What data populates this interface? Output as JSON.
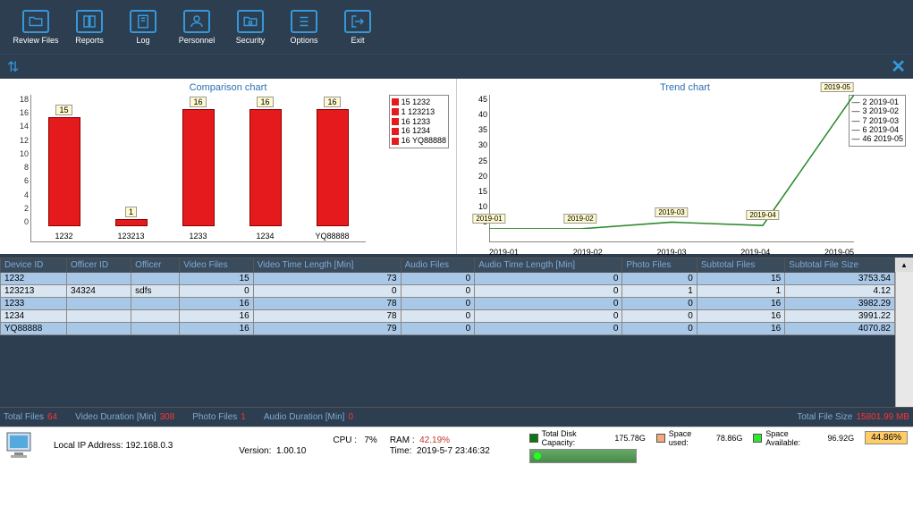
{
  "toolbar": {
    "items": [
      {
        "label": "Review Files",
        "icon": "folder"
      },
      {
        "label": "Reports",
        "icon": "book"
      },
      {
        "label": "Log",
        "icon": "notebook"
      },
      {
        "label": "Personnel",
        "icon": "person"
      },
      {
        "label": "Security",
        "icon": "folder-lock"
      },
      {
        "label": "Options",
        "icon": "list"
      },
      {
        "label": "Exit",
        "icon": "exit"
      }
    ]
  },
  "chart_data": [
    {
      "type": "bar",
      "title": "Comparison chart",
      "categories": [
        "1232",
        "123213",
        "1233",
        "1234",
        "YQ88888"
      ],
      "values": [
        15,
        1,
        16,
        16,
        16
      ],
      "ylim": [
        0,
        18
      ],
      "yticks": [
        0,
        2,
        4,
        6,
        8,
        10,
        12,
        14,
        16,
        18
      ],
      "legend": [
        {
          "color": "#e41a1c",
          "label": "15 1232"
        },
        {
          "color": "#e41a1c",
          "label": "1 123213"
        },
        {
          "color": "#e41a1c",
          "label": "16 1233"
        },
        {
          "color": "#e41a1c",
          "label": "16 1234"
        },
        {
          "color": "#e41a1c",
          "label": "16 YQ88888"
        }
      ]
    },
    {
      "type": "line",
      "title": "Trend chart",
      "x": [
        "2019-01",
        "2019-02",
        "2019-03",
        "2019-04",
        "2019-05"
      ],
      "values": [
        2,
        3,
        7,
        6,
        46
      ],
      "ylim": [
        5,
        45
      ],
      "yticks": [
        5,
        10,
        15,
        20,
        25,
        30,
        35,
        40,
        45
      ],
      "legend": [
        {
          "label": "2 2019-01"
        },
        {
          "label": "3 2019-02"
        },
        {
          "label": "7 2019-03"
        },
        {
          "label": "6 2019-04"
        },
        {
          "label": "46 2019-05"
        }
      ],
      "point_labels": [
        "2019-01",
        "2019-02",
        "2019-03",
        "2019-04",
        "2019-05"
      ]
    }
  ],
  "table": {
    "headers": [
      "Device ID",
      "Officer ID",
      "Officer",
      "Video Files",
      "Video Time Length [Min]",
      "Audio Files",
      "Audio Time Length [Min]",
      "Photo Files",
      "Subtotal Files",
      "Subtotal File Size"
    ],
    "rows": [
      {
        "device_id": "1232",
        "officer_id": "",
        "officer": "",
        "video_files": "15",
        "video_time": "73",
        "audio_files": "0",
        "audio_time": "0",
        "photo_files": "0",
        "subtotal_files": "15",
        "subtotal_size": "3753.54"
      },
      {
        "device_id": "123213",
        "officer_id": "34324",
        "officer": "sdfs",
        "video_files": "0",
        "video_time": "0",
        "audio_files": "0",
        "audio_time": "0",
        "photo_files": "1",
        "subtotal_files": "1",
        "subtotal_size": "4.12"
      },
      {
        "device_id": "1233",
        "officer_id": "",
        "officer": "",
        "video_files": "16",
        "video_time": "78",
        "audio_files": "0",
        "audio_time": "0",
        "photo_files": "0",
        "subtotal_files": "16",
        "subtotal_size": "3982.29"
      },
      {
        "device_id": "1234",
        "officer_id": "",
        "officer": "",
        "video_files": "16",
        "video_time": "78",
        "audio_files": "0",
        "audio_time": "0",
        "photo_files": "0",
        "subtotal_files": "16",
        "subtotal_size": "3991.22"
      },
      {
        "device_id": "YQ88888",
        "officer_id": "",
        "officer": "",
        "video_files": "16",
        "video_time": "79",
        "audio_files": "0",
        "audio_time": "0",
        "photo_files": "0",
        "subtotal_files": "16",
        "subtotal_size": "4070.82"
      }
    ]
  },
  "summary": {
    "total_files_label": "Total Files",
    "total_files": "64",
    "video_duration_label": "Video Duration [Min]",
    "video_duration": "308",
    "photo_files_label": "Photo Files",
    "photo_files": "1",
    "audio_duration_label": "Audio Duration [Min]",
    "audio_duration": "0",
    "total_file_size_label": "Total File Size",
    "total_file_size": "15801.99 MB"
  },
  "status": {
    "ip_label": "Local IP Address:",
    "ip": "192.168.0.3",
    "version_label": "Version:",
    "version": "1.00.10",
    "cpu_label": "CPU :",
    "cpu": "7%",
    "ram_label": "RAM :",
    "ram": "42.19%",
    "time_label": "Time:",
    "time": "2019-5-7 23:46:32",
    "disk_capacity_label": "Total Disk Capacity:",
    "disk_capacity": "175.78G",
    "space_used_label": "Space used:",
    "space_used": "78.86G",
    "space_available_label": "Space Available:",
    "space_available": "96.92G",
    "disk_pct": "44.86%"
  }
}
